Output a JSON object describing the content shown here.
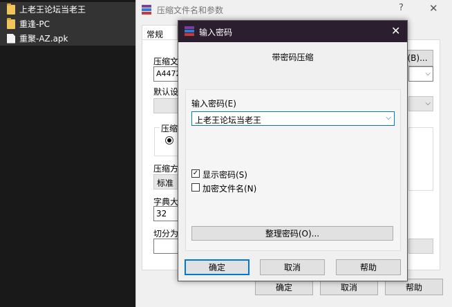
{
  "explorer": {
    "files": [
      {
        "name": "上老王论坛当老王",
        "type": "folder",
        "selected": true
      },
      {
        "name": "重逢-PC",
        "type": "folder",
        "selected": true
      },
      {
        "name": "重聚-AZ.apk",
        "type": "file",
        "selected": true
      }
    ]
  },
  "back_dialog": {
    "title": "压缩文件名和参数",
    "help_glyph": "?",
    "close_glyph": "✕",
    "tab_general": "常规",
    "archive_name_label": "压缩文",
    "archive_name_value": "A4472",
    "browse_button": "(B)...",
    "default_settings_label": "默认设",
    "format_group_label": "压缩",
    "method_label": "压缩方",
    "method_value": "标准",
    "dict_label": "字典大",
    "dict_value": "32",
    "split_label": "切分为",
    "ok_button": "确定",
    "cancel_button": "取消",
    "help_button": "帮助"
  },
  "password_dialog": {
    "title": "输入密码",
    "close_glyph": "✕",
    "subtitle": "带密码压缩",
    "password_label": "输入密码(E)",
    "password_value": "上老王论坛当老王",
    "show_password_label": "显示密码(S)",
    "show_password_checked": true,
    "encrypt_names_label": "加密文件名(N)",
    "encrypt_names_checked": false,
    "organize_button": "整理密码(O)...",
    "ok_button": "确定",
    "cancel_button": "取消",
    "help_button": "帮助"
  },
  "colors": {
    "titlebar_dark": "#2b1e2e",
    "focus_blue": "#0078d7"
  }
}
